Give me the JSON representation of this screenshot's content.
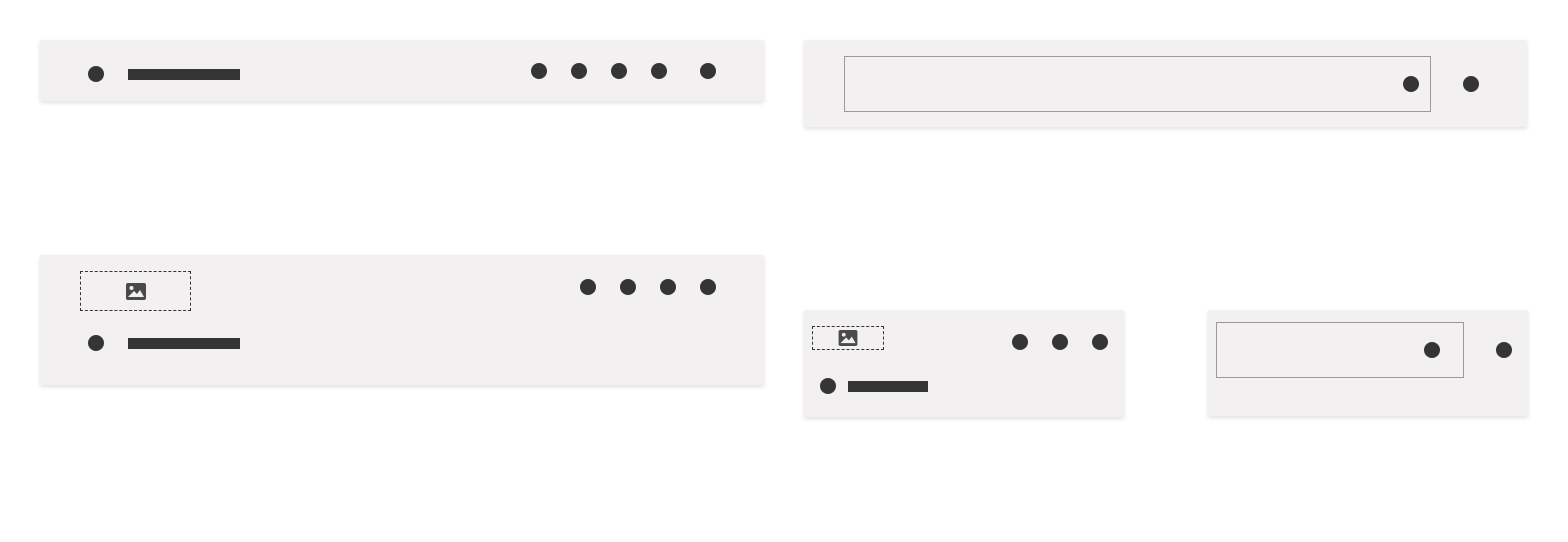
{
  "colors": {
    "bar_background": "#f2f0f1",
    "icon_fill": "#353535",
    "search_border": "#9a9a9a",
    "page_background": "#ffffff"
  },
  "icons": {
    "menu": "circle-icon",
    "nav": "circle-icon",
    "search": "circle-icon",
    "logo": "image-icon"
  }
}
